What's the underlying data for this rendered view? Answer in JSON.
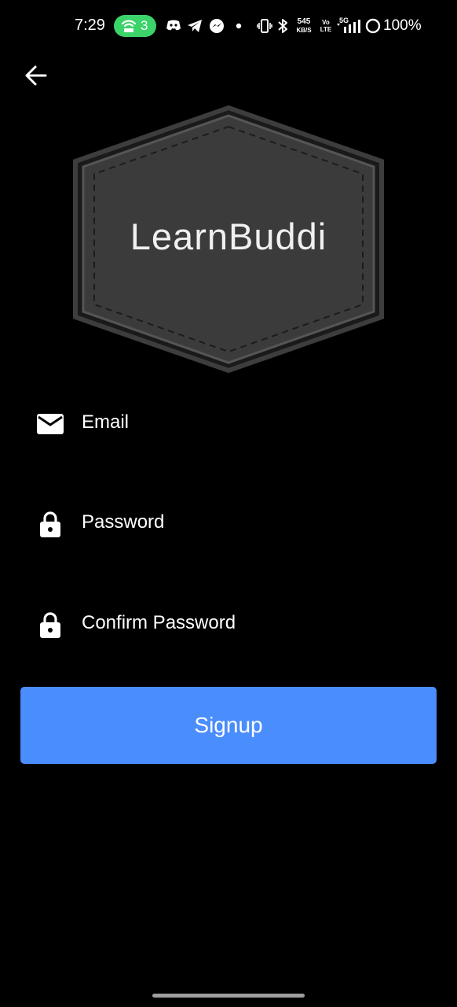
{
  "status_bar": {
    "time": "7:29",
    "hotspot_count": "3",
    "net_speed_value": "545",
    "net_speed_unit": "KB/S",
    "volte_line1": "Vo",
    "volte_line2": "LTE",
    "network_type": "5G",
    "battery": "100%",
    "icons": [
      "hotspot-icon",
      "discord-icon",
      "telegram-icon",
      "messenger-icon",
      "dot-icon",
      "vibrate-icon",
      "bluetooth-icon",
      "signal-icon",
      "battery-ring-icon"
    ],
    "hotspot_color": "#3dd36b"
  },
  "header": {
    "back_icon": "arrow-left-icon"
  },
  "logo": {
    "text": "LearnBuddi",
    "fill_color": "#3a3a3a",
    "border_color": "#4a4a4a"
  },
  "form": {
    "email": {
      "icon": "mail-icon",
      "placeholder": "Email",
      "value": ""
    },
    "password": {
      "icon": "lock-icon",
      "placeholder": "Password",
      "value": ""
    },
    "confirm_password": {
      "icon": "lock-icon",
      "placeholder": "Confirm Password",
      "value": ""
    }
  },
  "signup": {
    "label": "Signup",
    "color": "#4a8dfc"
  }
}
